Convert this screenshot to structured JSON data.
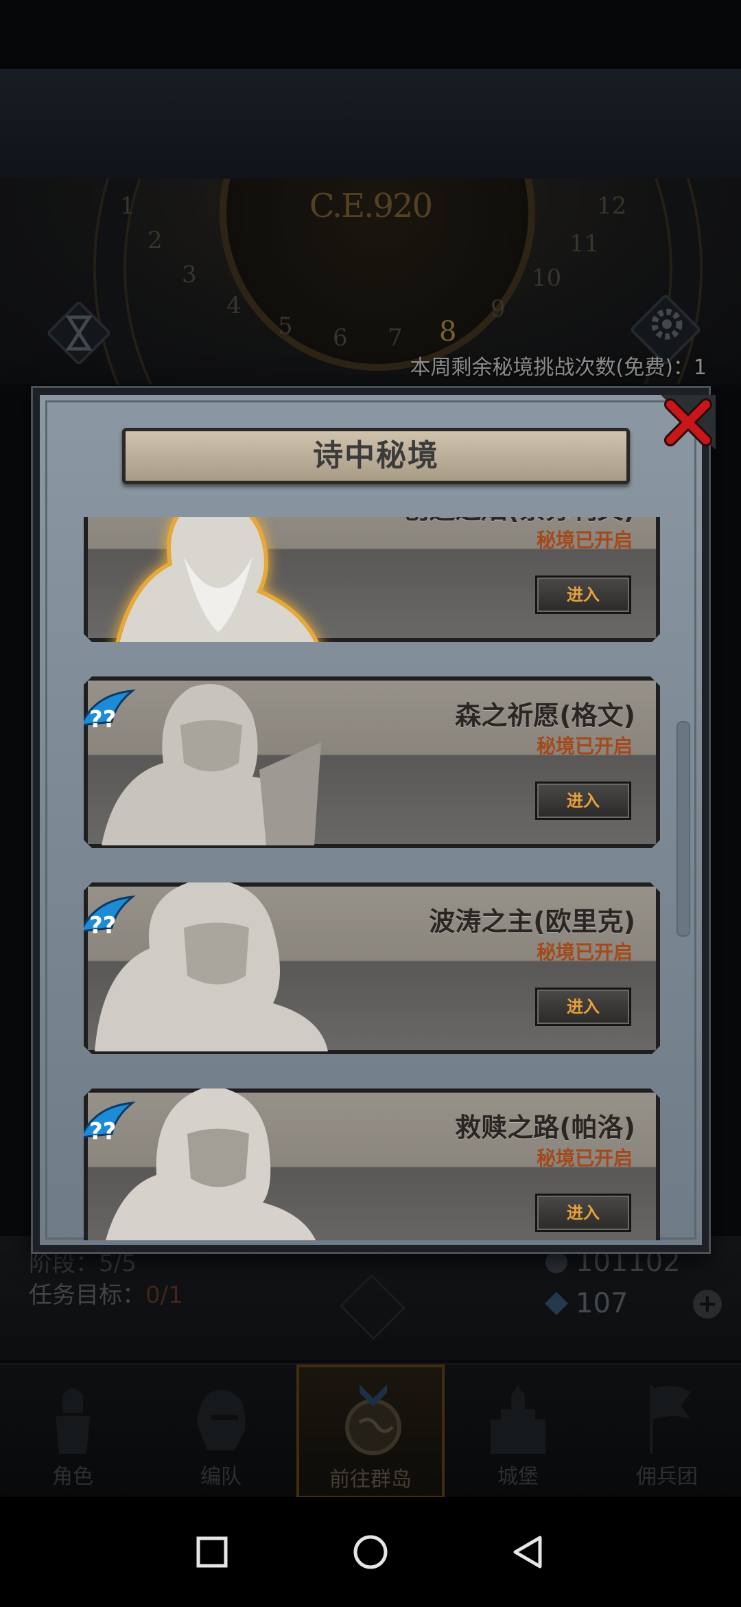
{
  "background": {
    "year_label": "C.E.920",
    "dial_numbers": [
      "1",
      "2",
      "3",
      "4",
      "5",
      "6",
      "7",
      "8",
      "9",
      "10",
      "11",
      "12"
    ],
    "active_dial_number": "8",
    "weekly_remaining_text": "本周剩余秘境挑战次数(免费)：1",
    "stage_label": "阶段：",
    "stage_value": "5/5",
    "task_label": "任务目标：",
    "task_value": "0/1",
    "resource_silver": "101102",
    "resource_gems": "107"
  },
  "dialog": {
    "title": "诗中秘境",
    "close_icon": "close-x-icon",
    "cards": [
      {
        "name": "创造之焰(索苏利文)",
        "status": "秘境已开启",
        "enter_label": "进入"
      },
      {
        "name": "森之祈愿(格文)",
        "status": "秘境已开启",
        "enter_label": "进入"
      },
      {
        "name": "波涛之主(欧里克)",
        "status": "秘境已开启",
        "enter_label": "进入"
      },
      {
        "name": "救赎之路(帕洛)",
        "status": "秘境已开启",
        "enter_label": "进入"
      }
    ]
  },
  "bottom_nav": {
    "items": [
      {
        "label": "角色",
        "icon": "knight-icon"
      },
      {
        "label": "编队",
        "icon": "helmet-icon"
      },
      {
        "label": "前往群岛",
        "icon": "compass-globe-icon"
      },
      {
        "label": "城堡",
        "icon": "castle-icon"
      },
      {
        "label": "佣兵团",
        "icon": "flag-icon"
      }
    ],
    "active_index": 2
  },
  "android_nav": {
    "recents_icon": "square-icon",
    "home_icon": "circle-icon",
    "back_icon": "triangle-back-icon"
  },
  "colors": {
    "status_text": "#a5481a",
    "enter_text": "#e8a23a",
    "close_red": "#c8161b"
  }
}
